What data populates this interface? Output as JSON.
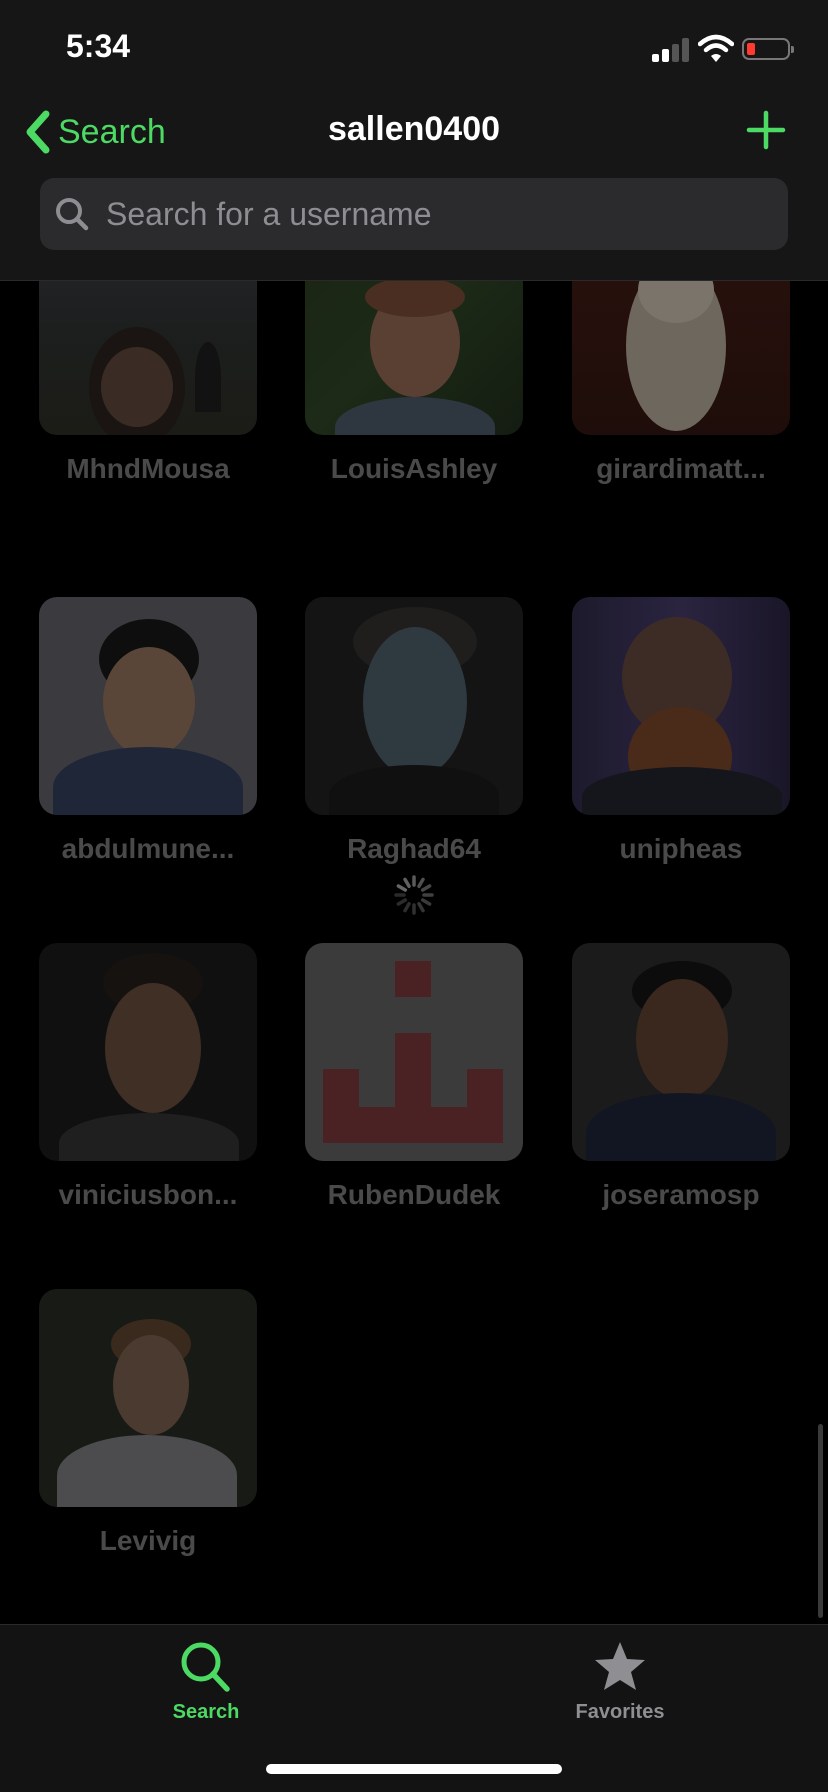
{
  "status_bar": {
    "time": "5:34"
  },
  "nav": {
    "back_label": "Search",
    "title": "sallen0400"
  },
  "search": {
    "placeholder": "Search for a username"
  },
  "users": [
    {
      "name": "MhndMousa"
    },
    {
      "name": "LouisAshley"
    },
    {
      "name": "girardimatt..."
    },
    {
      "name": "abdulmune..."
    },
    {
      "name": "Raghad64"
    },
    {
      "name": "unipheas"
    },
    {
      "name": "viniciusbon..."
    },
    {
      "name": "RubenDudek"
    },
    {
      "name": "joseramosp"
    },
    {
      "name": "Levivig"
    }
  ],
  "tabs": [
    {
      "label": "Search",
      "icon": "search-icon",
      "active": true
    },
    {
      "label": "Favorites",
      "icon": "star-icon",
      "active": false
    }
  ],
  "colors": {
    "accent": "#4cd964",
    "inactive_tab": "#8e8e93",
    "dimmed_text": "#4a4a4a"
  }
}
